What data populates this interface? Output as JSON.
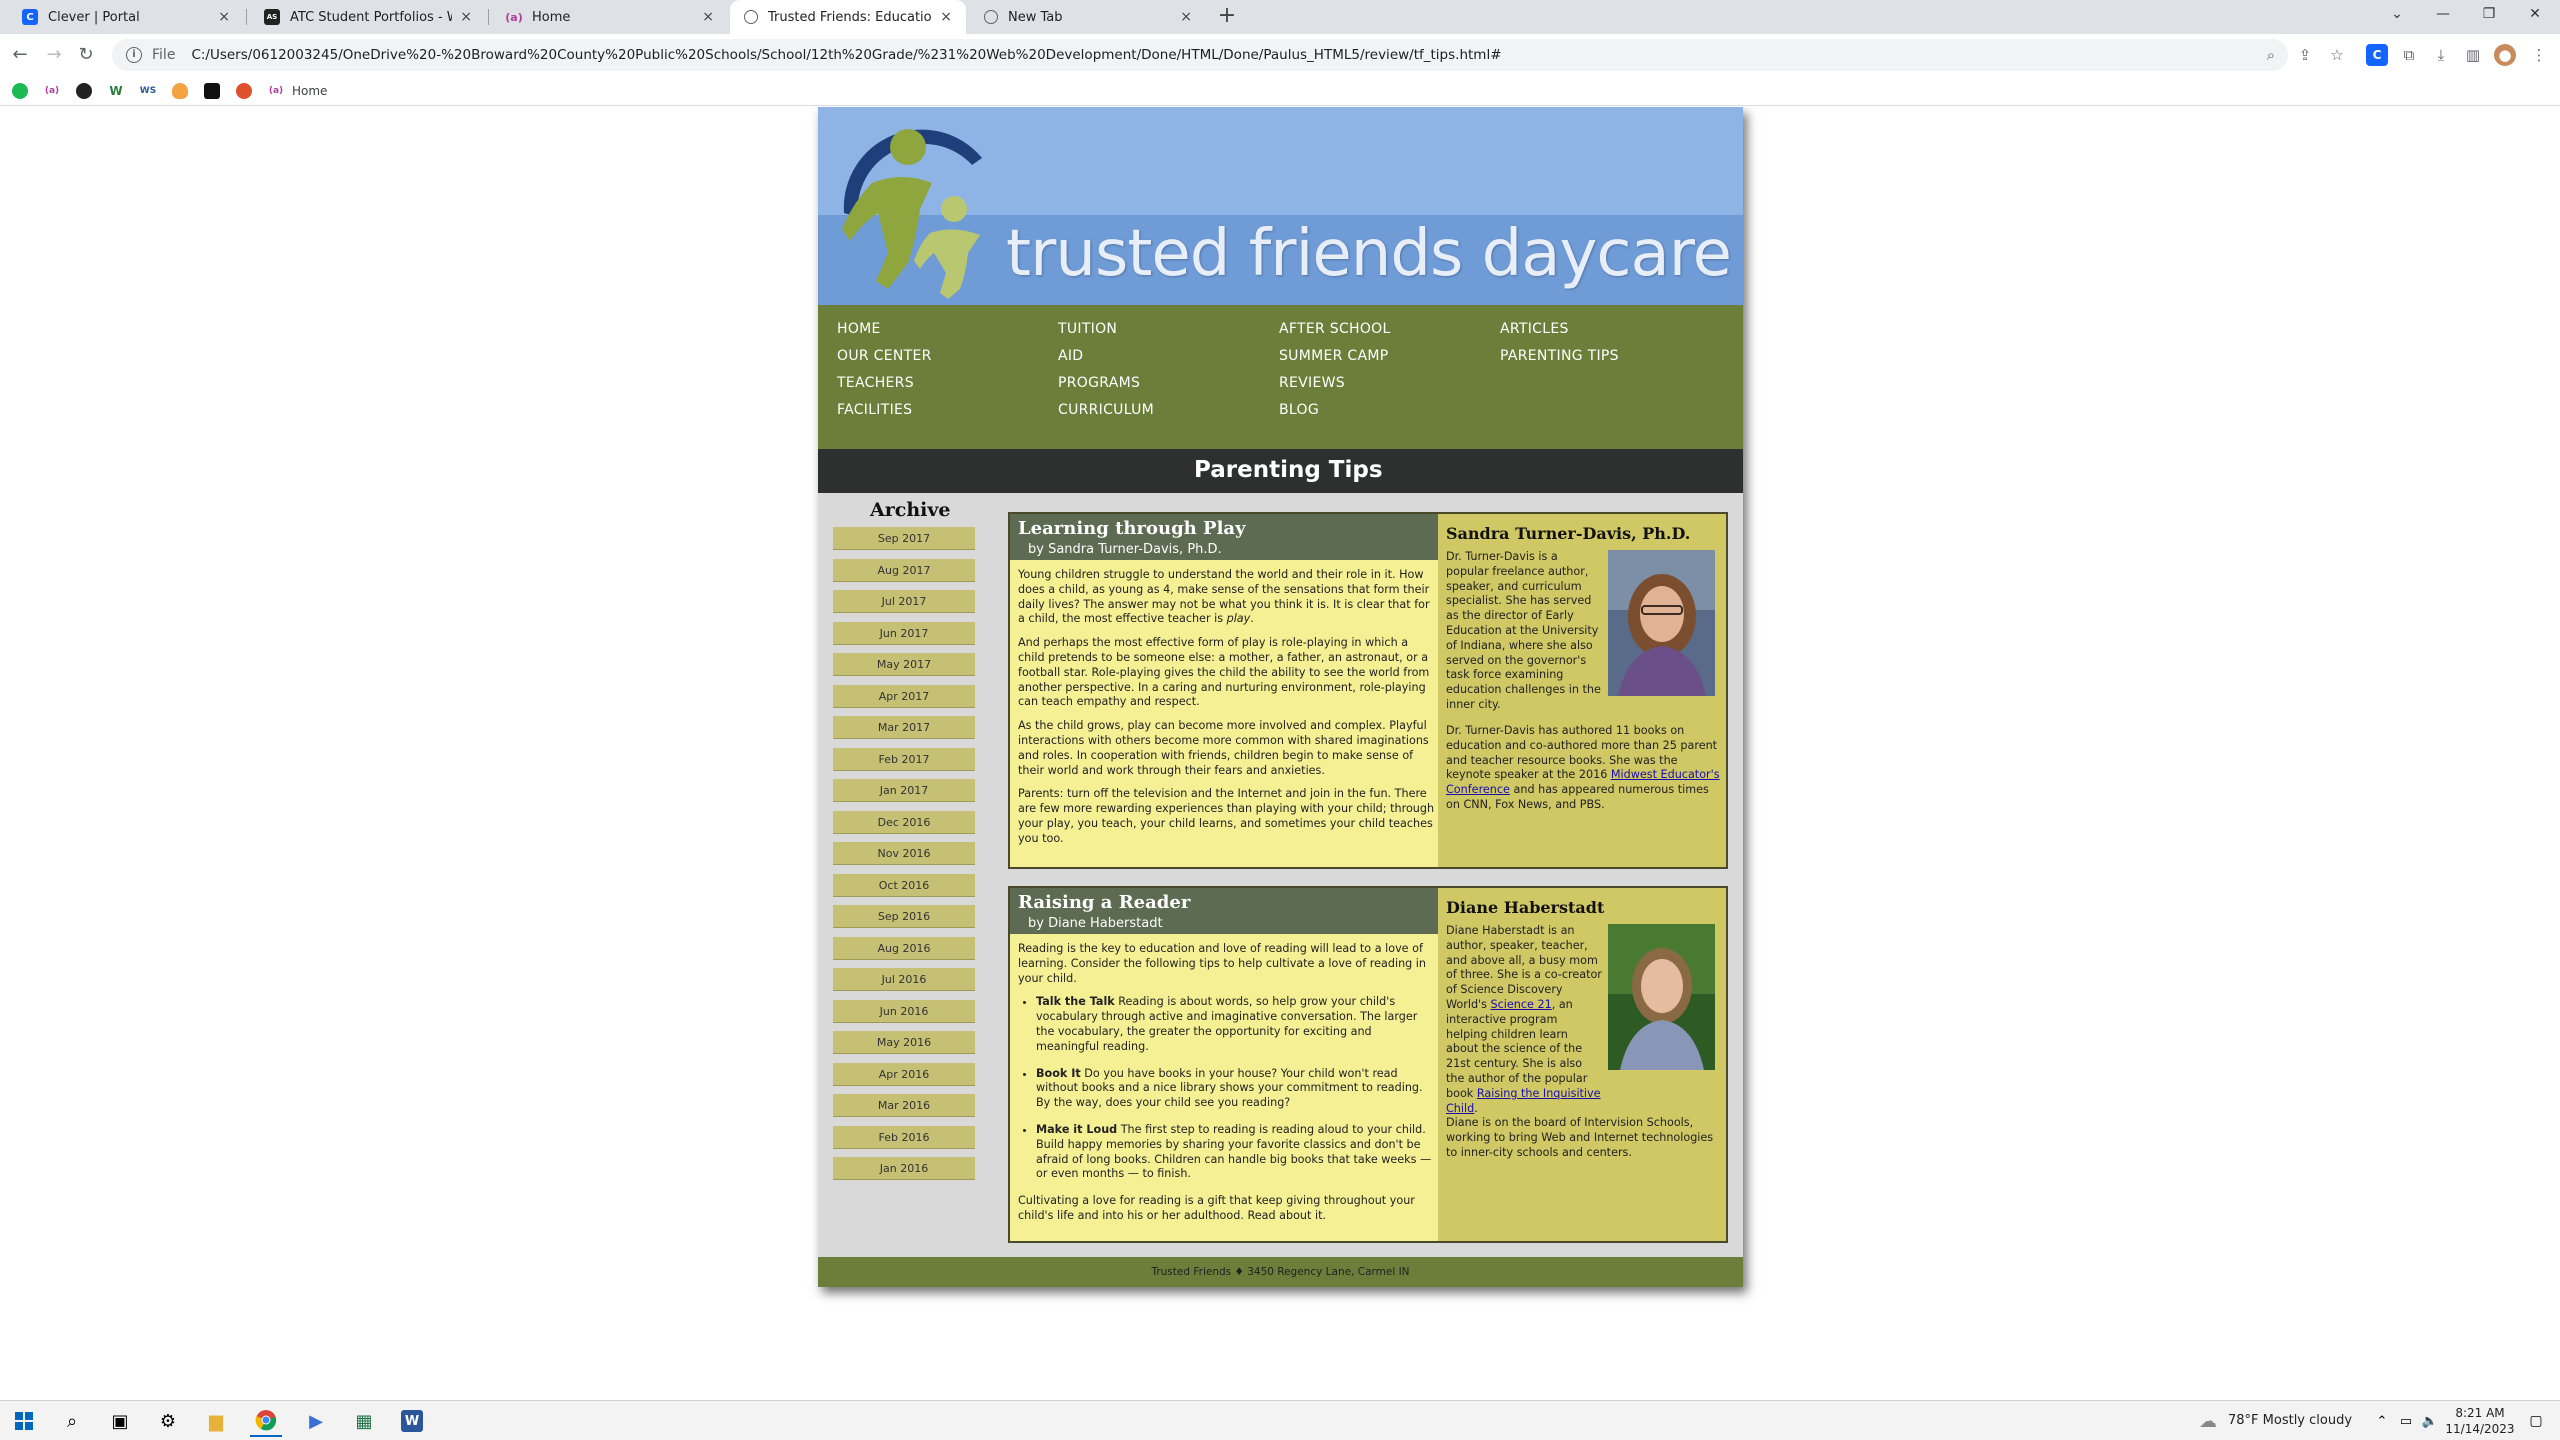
{
  "browser": {
    "tabs": [
      {
        "title": "Clever | Portal",
        "icon": "C",
        "color": "#1464ff"
      },
      {
        "title": "ATC Student Portfolios - Web De",
        "icon": "AS",
        "color": "#222222"
      },
      {
        "title": "Home",
        "icon": "(a)",
        "color": "#b0409c"
      },
      {
        "title": "Trusted Friends: Education Tips",
        "icon": "globe",
        "color": "#5f6368"
      },
      {
        "title": "New Tab",
        "icon": "globe",
        "color": "#5f6368"
      }
    ],
    "close_glyph": "×",
    "new_tab_glyph": "+",
    "file_label": "File",
    "url": "C:/Users/0612003245/OneDrive%20-%20Broward%20County%20Public%20Schools/School/12th%20Grade/%231%20Web%20Development/Done/HTML/Done/Paulus_HTML5/review/tf_tips.html#",
    "bookmarks": [
      {
        "icon": "spotify-icon",
        "color": "#1db954"
      },
      {
        "icon": "(a)",
        "color": "#b0409c"
      },
      {
        "icon": "github-icon",
        "color": "#222222"
      },
      {
        "icon": "W",
        "color": "#2a7d3a"
      },
      {
        "icon": "WS",
        "color": "#2b579a"
      },
      {
        "icon": "flame-icon",
        "color": "#f4a340"
      },
      {
        "icon": "bookmark-dark-icon",
        "color": "#111111"
      },
      {
        "icon": "basketball-icon",
        "color": "#e0502a"
      },
      {
        "icon": "(a)",
        "color": "#b0409c",
        "label": "Home"
      }
    ]
  },
  "site": {
    "banner_title": "trusted friends daycare",
    "nav": [
      [
        "HOME",
        "OUR CENTER",
        "TEACHERS",
        "FACILITIES"
      ],
      [
        "TUITION",
        "AID",
        "PROGRAMS",
        "CURRICULUM"
      ],
      [
        "AFTER SCHOOL",
        "SUMMER CAMP",
        "REVIEWS",
        "BLOG"
      ],
      [
        "ARTICLES",
        "PARENTING TIPS"
      ]
    ],
    "page_heading": "Parenting Tips",
    "archive": {
      "title": "Archive",
      "items": [
        "Sep 2017",
        "Aug 2017",
        "Jul 2017",
        "Jun 2017",
        "May 2017",
        "Apr 2017",
        "Mar 2017",
        "Feb 2017",
        "Jan 2017",
        "Dec 2016",
        "Nov 2016",
        "Oct 2016",
        "Sep 2016",
        "Aug 2016",
        "Jul 2016",
        "Jun 2016",
        "May 2016",
        "Apr 2016",
        "Mar 2016",
        "Feb 2016",
        "Jan 2016"
      ]
    },
    "article1": {
      "title": "Learning through Play",
      "byline": "by Sandra Turner-Davis, Ph.D.",
      "p1_a": "Young children struggle to understand the world and their role in it. How does a child, as young as 4, make sense of the sensations that form their daily lives? The answer may not be what you think it is. It is clear that for a child, the most effective teacher is ",
      "p1_em": "play",
      "p1_b": ".",
      "p2": "And perhaps the most effective form of play is role-playing in which a child pretends to be someone else: a mother, a father, an astronaut, or a football star. Role-playing gives the child the ability to see the world from another perspective. In a caring and nurturing environment, role-playing can teach empathy and respect.",
      "p3": "As the child grows, play can become more involved and complex. Playful interactions with others become more common with shared imaginations and roles. In cooperation with friends, children begin to make sense of their world and work through their fears and anxieties.",
      "p4": "Parents: turn off the television and the Internet and join in the fun. There are few more rewarding experiences than playing with your child; through your play, you teach, your child learns, and sometimes your child teaches you too.",
      "author": {
        "name": "Sandra Turner-Davis, Ph.D.",
        "bio1": "Dr. Turner-Davis is a popular freelance author, speaker, and curriculum specialist. She has served as the director of Early Education at the University of Indiana, where she also served on the governor's task force examining education challenges in the inner city.",
        "bio2_a": "Dr. Turner-Davis has authored 11 books on education and co-authored more than 25 parent and teacher resource books. She was the keynote speaker at the 2016 ",
        "bio2_link": "Midwest Educator's Conference",
        "bio2_b": " and has appeared numerous times on CNN, Fox News, and PBS."
      }
    },
    "article2": {
      "title": "Raising a Reader",
      "byline": "by Diane Haberstadt",
      "intro": "Reading is the key to education and love of reading will lead to a love of learning. Consider the following tips to help cultivate a love of reading in your child.",
      "tips": [
        {
          "head": "Talk the Talk",
          "text": " Reading is about words, so help grow your child's vocabulary through active and imaginative conversation. The larger the vocabulary, the greater the opportunity for exciting and meaningful reading."
        },
        {
          "head": "Book It",
          "text": " Do you have books in your house? Your child won't read without books and a nice library shows your commitment to reading. By the way, does your child see you reading?"
        },
        {
          "head": "Make it Loud",
          "text": " The first step to reading is reading aloud to your child. Build happy memories by sharing your favorite classics and don't be afraid of long books. Children can handle big books that take weeks — or even months — to finish."
        }
      ],
      "closing": "Cultivating a love for reading is a gift that keep giving throughout your child's life and into his or her adulthood. Read about it.",
      "author": {
        "name": "Diane Haberstadt",
        "bio1_a": "Diane Haberstadt is an author, speaker, teacher, and above all, a busy mom of three. She is a co-creator of Science Discovery World's ",
        "bio1_link1": "Science 21",
        "bio1_b": ", an interactive program helping children learn about the science of the 21st century. She is also the author of the popular book ",
        "bio1_link2": "Raising the Inquisitive Child",
        "bio1_c": ".",
        "bio2": "Diane is on the board of Intervision Schools, working to bring Web and Internet technologies to inner-city schools and centers."
      }
    },
    "footer": "Trusted Friends ♦ 3450 Regency Lane, Carmel IN",
    "colors": {
      "nav_green": "#6b7f3a",
      "banner_blue": "#8eb4e6",
      "article_yellow": "#f6f094",
      "sidebar_olive": "#cfc864",
      "archive_button": "#c5c074"
    }
  },
  "taskbar": {
    "weather": "78°F  Mostly cloudy",
    "time": "8:21 AM",
    "date": "11/14/2023"
  }
}
